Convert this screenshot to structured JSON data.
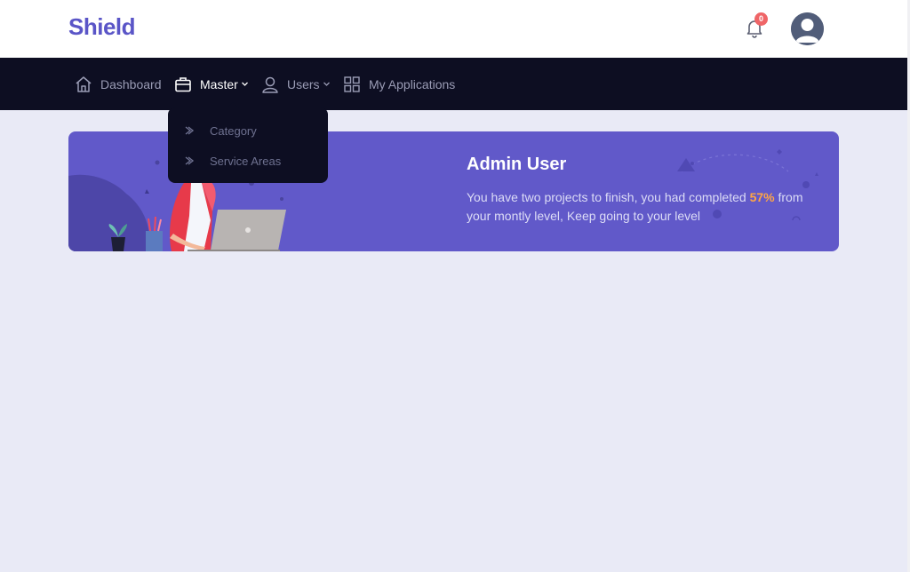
{
  "brand": {
    "name": "Shield",
    "color": "#5a55c7"
  },
  "header": {
    "notification_count": "0",
    "bell_icon": "bell-icon",
    "avatar_icon": "user-avatar-icon"
  },
  "nav": {
    "items": [
      {
        "label": "Dashboard",
        "icon": "home-icon"
      },
      {
        "label": "Master",
        "icon": "briefcase-icon",
        "active": true,
        "dropdown": true
      },
      {
        "label": "Users",
        "icon": "user-icon",
        "dropdown": true
      },
      {
        "label": "My Applications",
        "icon": "grid-icon"
      }
    ]
  },
  "master_dropdown": {
    "items": [
      {
        "label": "Category",
        "icon": "chevron-right-icon"
      },
      {
        "label": "Service Areas",
        "icon": "chevron-right-icon"
      }
    ]
  },
  "banner": {
    "title": "Admin User",
    "text_before": "You have two projects to finish, you had completed ",
    "highlight": "57%",
    "text_after": " from your montly level, Keep going to your level"
  },
  "colors": {
    "accent": "#6159c9",
    "nav_bg": "#0d0e22",
    "badge": "#ef6567",
    "highlight": "#ffa545",
    "page_bg": "#e9eaf6"
  }
}
